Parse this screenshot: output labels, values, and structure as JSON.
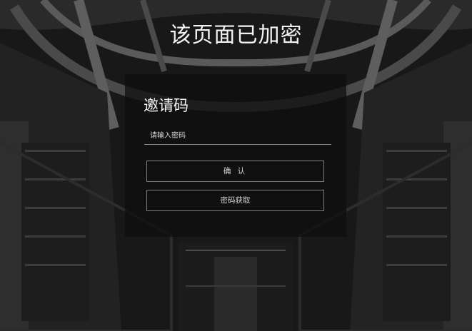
{
  "page": {
    "title": "该页面已加密"
  },
  "card": {
    "title": "邀请码",
    "input_placeholder": "请输入密码",
    "input_value": "",
    "confirm_label": "确 认",
    "get_password_label": "密码获取"
  },
  "colors": {
    "background": "#161616",
    "card_background": "rgba(14,14,14,0.74)",
    "button_border": "#7d7d7d",
    "text": "#f2f2f2"
  }
}
